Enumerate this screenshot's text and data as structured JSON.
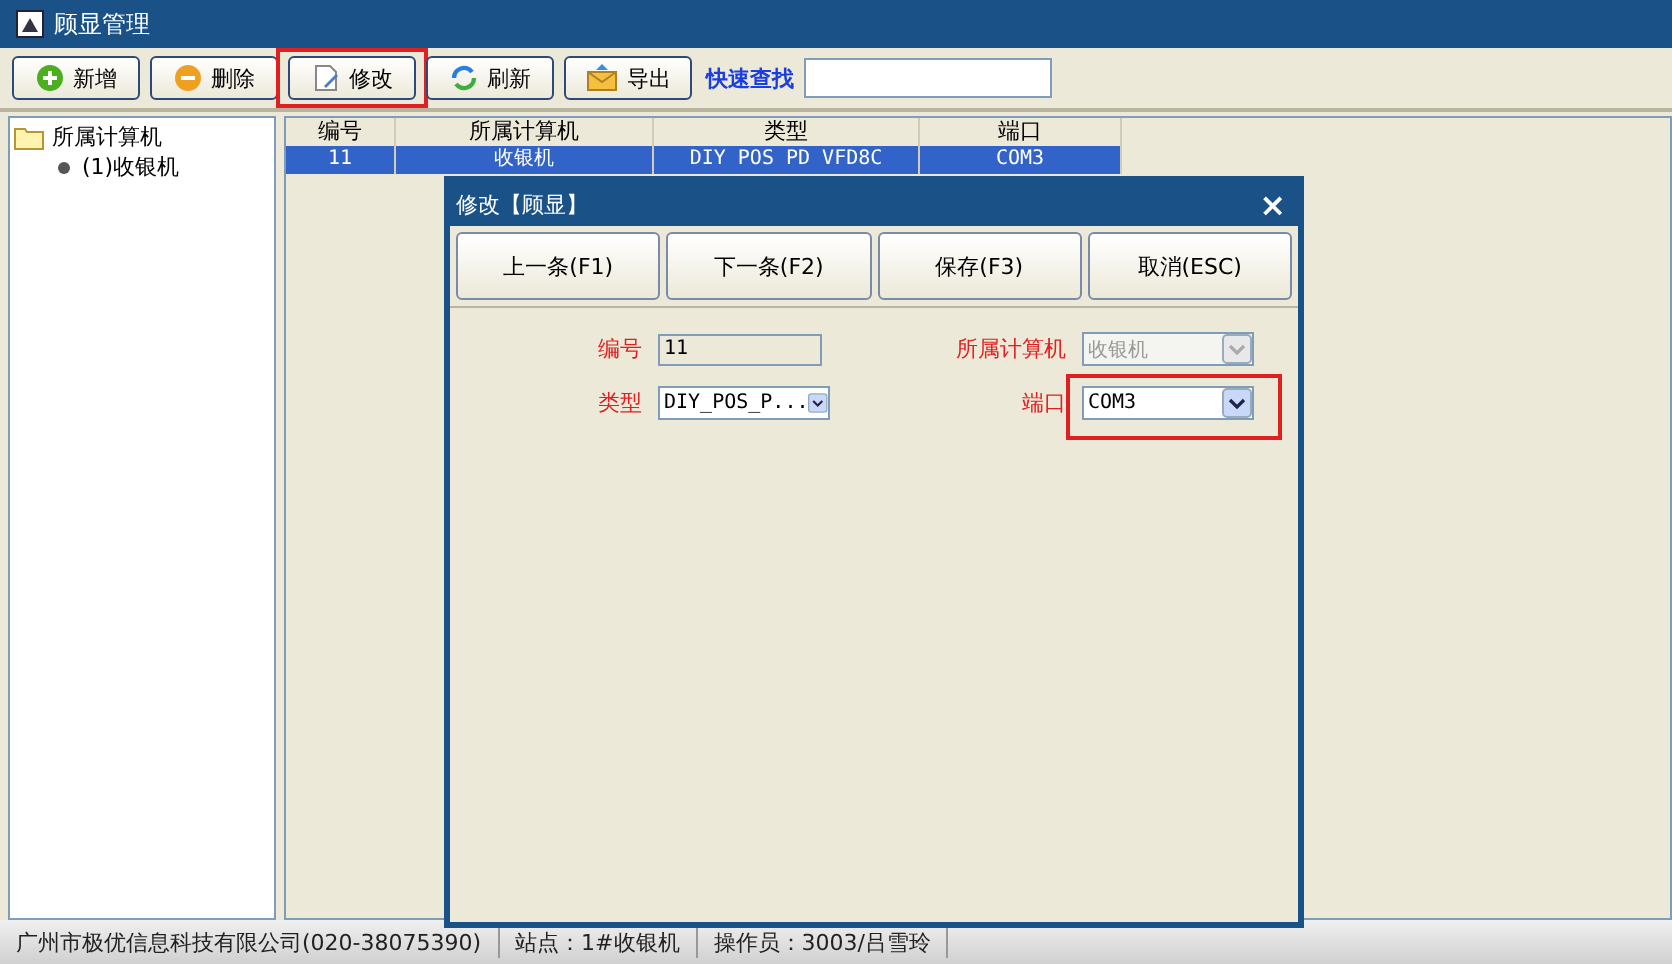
{
  "window": {
    "title": "顾显管理"
  },
  "toolbar": {
    "buttons": [
      {
        "label": "新增",
        "kind": "add",
        "highlighted": false
      },
      {
        "label": "删除",
        "kind": "remove",
        "highlighted": false
      },
      {
        "label": "修改",
        "kind": "edit",
        "highlighted": true
      },
      {
        "label": "刷新",
        "kind": "refresh",
        "highlighted": false
      },
      {
        "label": "导出",
        "kind": "export",
        "highlighted": false
      }
    ],
    "search_label": "快速查找"
  },
  "tree": {
    "items": [
      {
        "label": "所属计算机",
        "expanded": true,
        "children": [
          {
            "label": "(1)收银机"
          }
        ]
      }
    ]
  },
  "table": {
    "columns": [
      "编号",
      "所属计算机",
      "类型",
      "端口"
    ],
    "rows": [
      {
        "cells": [
          "11",
          "收银机",
          "DIY POS PD VFD8C",
          "COM3"
        ],
        "selected": true
      }
    ]
  },
  "dialog": {
    "title": "修改【顾显】",
    "close": "×",
    "buttons": [
      "上一条(F1)",
      "下一条(F2)",
      "保存(F3)",
      "取消(ESC)"
    ],
    "fields": [
      {
        "label": "编号",
        "value": "11",
        "kind": "text",
        "disabled": false,
        "highlighted": false
      },
      {
        "label": "所属计算机",
        "value": "收银机",
        "kind": "select",
        "disabled": true,
        "highlighted": false
      },
      {
        "label": "类型",
        "value": "DIY_POS_P...",
        "kind": "select",
        "disabled": false,
        "highlighted": false
      },
      {
        "label": "端口",
        "value": "COM3",
        "kind": "select",
        "disabled": false,
        "highlighted": true
      }
    ]
  },
  "status_bar": [
    "广州市极优信息科技有限公司(020-38075390)",
    "站点：1#收银机",
    "操作员：3003/吕雪玲"
  ]
}
